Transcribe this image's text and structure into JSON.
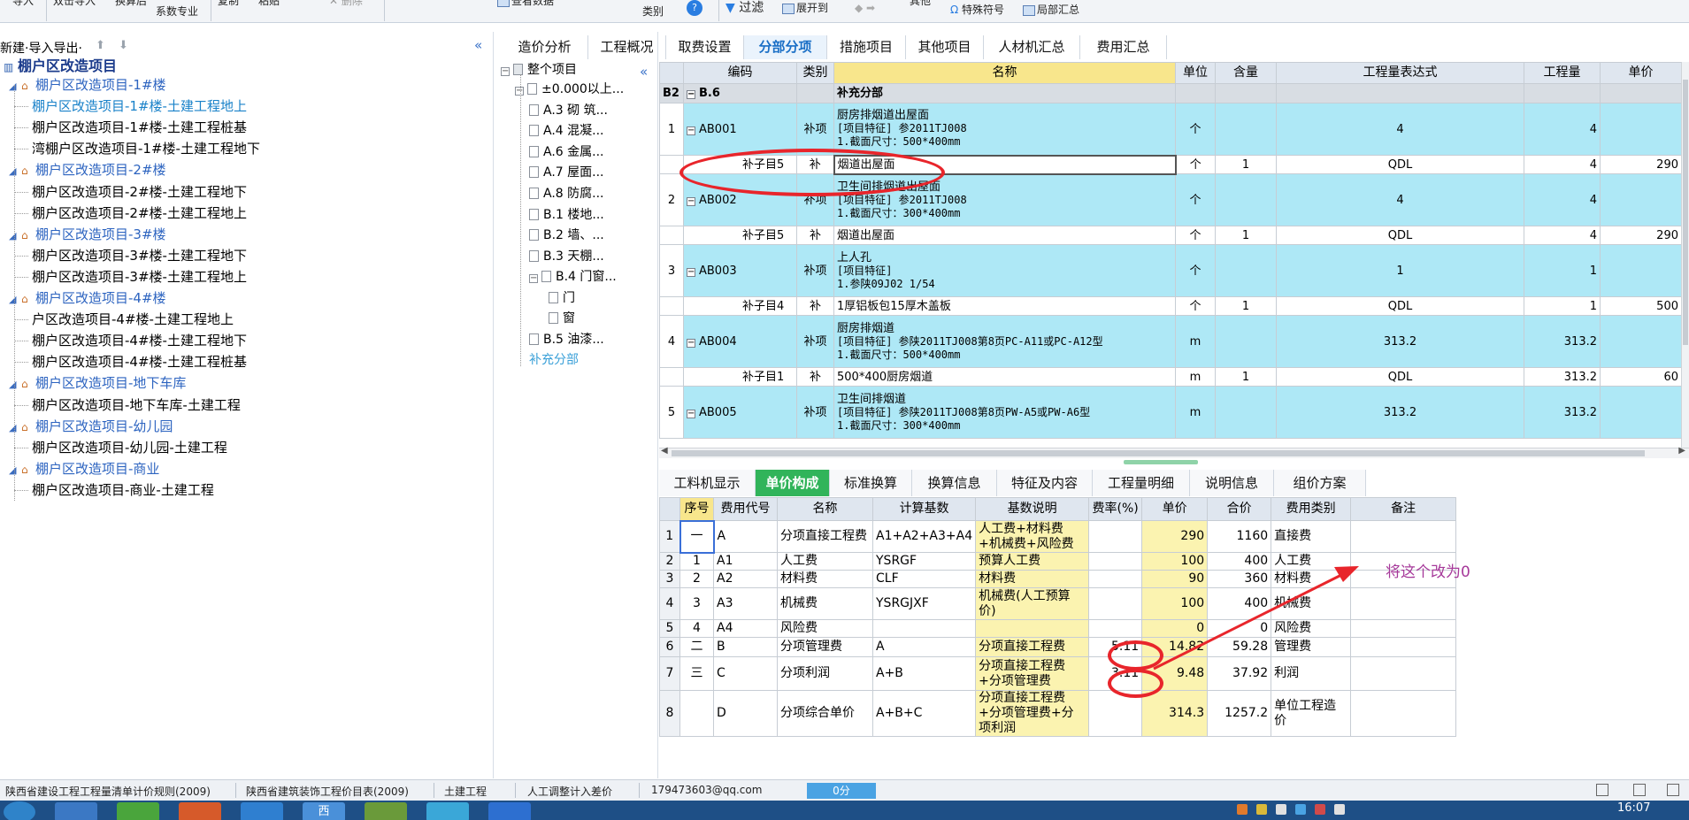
{
  "toolbar": {
    "frag1": "导入",
    "frag2": "双击导入",
    "frag3": "换算后",
    "frag4": "系数专业",
    "frag5": "复制",
    "frag6": "粘贴",
    "frag7": "删除",
    "frag8": "查看数据",
    "frag9": "类别",
    "frag10": "过滤",
    "frag11": "展开到",
    "frag12": "特殊符号",
    "frag13": "局部汇总",
    "frag14": "其他"
  },
  "left_tree": {
    "header_label": "新建·导入导出·",
    "root": "棚户区改造项目",
    "nodes": [
      {
        "label": "棚户区改造项目-1#楼",
        "type": "group"
      },
      {
        "label": "棚户区改造项目-1#楼-土建工程地上",
        "type": "selected"
      },
      {
        "label": "棚户区改造项目-1#楼-土建工程桩基",
        "type": "leaf"
      },
      {
        "label": "湾棚户区改造项目-1#楼-土建工程地下",
        "type": "leaf"
      },
      {
        "label": "棚户区改造项目-2#楼",
        "type": "group"
      },
      {
        "label": "棚户区改造项目-2#楼-土建工程地下",
        "type": "leaf"
      },
      {
        "label": "棚户区改造项目-2#楼-土建工程地上",
        "type": "leaf"
      },
      {
        "label": "棚户区改造项目-3#楼",
        "type": "group"
      },
      {
        "label": "棚户区改造项目-3#楼-土建工程地下",
        "type": "leaf"
      },
      {
        "label": "棚户区改造项目-3#楼-土建工程地上",
        "type": "leaf"
      },
      {
        "label": "棚户区改造项目-4#楼",
        "type": "group"
      },
      {
        "label": "户区改造项目-4#楼-土建工程地上",
        "type": "leaf"
      },
      {
        "label": "棚户区改造项目-4#楼-土建工程地下",
        "type": "leaf"
      },
      {
        "label": "棚户区改造项目-4#楼-土建工程桩基",
        "type": "leaf"
      },
      {
        "label": "棚户区改造项目-地下车库",
        "type": "group"
      },
      {
        "label": "棚户区改造项目-地下车库-土建工程",
        "type": "leaf"
      },
      {
        "label": "棚户区改造项目-幼儿园",
        "type": "group"
      },
      {
        "label": "棚户区改造项目-幼儿园-土建工程",
        "type": "leaf"
      },
      {
        "label": "棚户区改造项目-商业",
        "type": "group"
      },
      {
        "label": "棚户区改造项目-商业-土建工程",
        "type": "leaf"
      }
    ]
  },
  "mid_tree": {
    "nodes": [
      {
        "label": "整个项目"
      },
      {
        "label": "±0.000以上..."
      },
      {
        "label": "A.3 砌 筑..."
      },
      {
        "label": "A.4 混凝..."
      },
      {
        "label": "A.6 金属..."
      },
      {
        "label": "A.7 屋面..."
      },
      {
        "label": "A.8 防腐..."
      },
      {
        "label": "B.1 楼地..."
      },
      {
        "label": "B.2 墙、..."
      },
      {
        "label": "B.3 天棚..."
      },
      {
        "label": "B.4 门窗..."
      },
      {
        "label": "门"
      },
      {
        "label": "窗"
      },
      {
        "label": "B.5 油漆..."
      },
      {
        "label": "补充分部"
      }
    ]
  },
  "tabs": [
    "造价分析",
    "工程概况",
    "取费设置",
    "分部分项",
    "措施项目",
    "其他项目",
    "人材机汇总",
    "费用汇总"
  ],
  "top_grid": {
    "headers": [
      "编码",
      "类别",
      "名称",
      "单位",
      "含量",
      "工程量表达式",
      "工程量",
      "单价"
    ],
    "section": {
      "idx": "B2",
      "code": "B.6",
      "name": "补充分部"
    },
    "rows": [
      {
        "kind": "item",
        "idx": "1",
        "code": "AB001",
        "cat": "补项",
        "name1": "厨房排烟道出屋面",
        "name2": "[项目特征]  参2011TJ008",
        "name3": "1.截面尺寸：500*400mm",
        "unit": "个",
        "content": "",
        "expr": "4",
        "qty": "4",
        "price": ""
      },
      {
        "kind": "sub",
        "idx": "",
        "code": "补子目5",
        "cat": "补",
        "name1": "烟道出屋面",
        "unit": "个",
        "content": "1",
        "expr": "QDL",
        "qty": "4",
        "price": "290",
        "selected": true
      },
      {
        "kind": "item",
        "idx": "2",
        "code": "AB002",
        "cat": "补项",
        "name1": "卫生间排烟道出屋面",
        "name2": "[项目特征]  参2011TJ008",
        "name3": "1.截面尺寸：300*400mm",
        "unit": "个",
        "content": "",
        "expr": "4",
        "qty": "4",
        "price": ""
      },
      {
        "kind": "sub",
        "idx": "",
        "code": "补子目5",
        "cat": "补",
        "name1": "烟道出屋面",
        "unit": "个",
        "content": "1",
        "expr": "QDL",
        "qty": "4",
        "price": "290"
      },
      {
        "kind": "item",
        "idx": "3",
        "code": "AB003",
        "cat": "补项",
        "name1": "上人孔",
        "name2": "[项目特征]",
        "name3": "1.参陕09J02 1/54",
        "unit": "个",
        "content": "",
        "expr": "1",
        "qty": "1",
        "price": ""
      },
      {
        "kind": "sub",
        "idx": "",
        "code": "补子目4",
        "cat": "补",
        "name1": "1厚铝板包15厚木盖板",
        "unit": "个",
        "content": "1",
        "expr": "QDL",
        "qty": "1",
        "price": "500"
      },
      {
        "kind": "item",
        "idx": "4",
        "code": "AB004",
        "cat": "补项",
        "name1": "厨房排烟道",
        "name2": "[项目特征]  参陕2011TJ008第8页PC-A11或PC-A12型",
        "name3": "1.截面尺寸：500*400mm",
        "unit": "m",
        "content": "",
        "expr": "313.2",
        "qty": "313.2",
        "price": ""
      },
      {
        "kind": "sub",
        "idx": "",
        "code": "补子目1",
        "cat": "补",
        "name1": "500*400厨房烟道",
        "unit": "m",
        "content": "1",
        "expr": "QDL",
        "qty": "313.2",
        "price": "60"
      },
      {
        "kind": "item",
        "idx": "5",
        "code": "AB005",
        "cat": "补项",
        "name1": "卫生间排烟道",
        "name2": "[项目特征]  参陕2011TJ008第8页PW-A5或PW-A6型",
        "name3": "1.截面尺寸：300*400mm",
        "unit": "m",
        "content": "",
        "expr": "313.2",
        "qty": "313.2",
        "price": ""
      }
    ]
  },
  "bottom_tabs": [
    "工料机显示",
    "单价构成",
    "标准换算",
    "换算信息",
    "特征及内容",
    "工程量明细",
    "说明信息",
    "组价方案"
  ],
  "bottom_grid": {
    "headers": [
      "序号",
      "费用代号",
      "名称",
      "计算基数",
      "基数说明",
      "费率(%)",
      "单价",
      "合价",
      "费用类别",
      "备注"
    ],
    "rows": [
      {
        "idx": "1",
        "seq": "一",
        "code": "A",
        "name": "分项直接工程费",
        "base": "A1+A2+A3+A4",
        "desc": "人工费+材料费+机械费+风险费",
        "rate": "",
        "price": "290",
        "total": "1160",
        "cat": "直接费",
        "note": ""
      },
      {
        "idx": "2",
        "seq": "1",
        "code": "A1",
        "name": "人工费",
        "base": "YSRGF",
        "desc": "预算人工费",
        "rate": "",
        "price": "100",
        "total": "400",
        "cat": "人工费",
        "note": ""
      },
      {
        "idx": "3",
        "seq": "2",
        "code": "A2",
        "name": "材料费",
        "base": "CLF",
        "desc": "材料费",
        "rate": "",
        "price": "90",
        "total": "360",
        "cat": "材料费",
        "note": ""
      },
      {
        "idx": "4",
        "seq": "3",
        "code": "A3",
        "name": "机械费",
        "base": "YSRGJXF",
        "desc": "机械费(人工预算价)",
        "rate": "",
        "price": "100",
        "total": "400",
        "cat": "机械费",
        "note": ""
      },
      {
        "idx": "5",
        "seq": "4",
        "code": "A4",
        "name": "风险费",
        "base": "",
        "desc": "",
        "rate": "",
        "price": "0",
        "total": "0",
        "cat": "风险费",
        "note": ""
      },
      {
        "idx": "6",
        "seq": "二",
        "code": "B",
        "name": "分项管理费",
        "base": "A",
        "desc": "分项直接工程费",
        "rate": "5.11",
        "price": "14.82",
        "total": "59.28",
        "cat": "管理费",
        "note": ""
      },
      {
        "idx": "7",
        "seq": "三",
        "code": "C",
        "name": "分项利润",
        "base": "A+B",
        "desc": "分项直接工程费+分项管理费",
        "rate": "3.11",
        "price": "9.48",
        "total": "37.92",
        "cat": "利润",
        "note": ""
      },
      {
        "idx": "8",
        "seq": "",
        "code": "D",
        "name": "分项综合单价",
        "base": "A+B+C",
        "desc": "分项直接工程费+分项管理费+分项利润",
        "rate": "",
        "price": "314.3",
        "total": "1257.2",
        "cat": "单位工程造价",
        "note": ""
      }
    ]
  },
  "annotation": {
    "note_text": "将这个改为0",
    "color": "#e8252b"
  },
  "status": {
    "s1": "陕西省建设工程工程量清单计价规则(2009)",
    "s2": "陕西省建筑装饰工程价目表(2009)",
    "s3": "土建工程",
    "s4": "人工调整计入差价",
    "s5": "179473603@qq.com",
    "progress": "0分"
  },
  "taskbar": {
    "clock": "16:07",
    "app_label": "西"
  }
}
